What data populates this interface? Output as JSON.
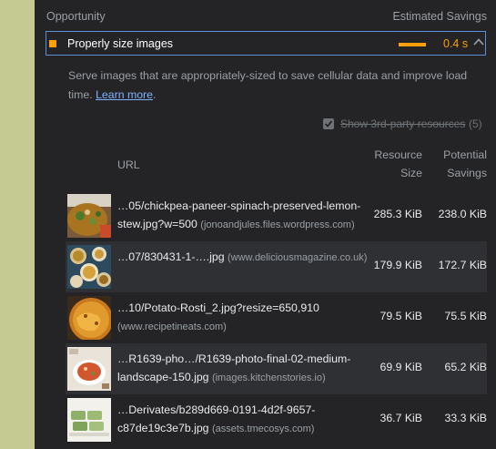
{
  "header": {
    "opportunity_label": "Opportunity",
    "estimated_savings_label": "Estimated Savings"
  },
  "audit": {
    "title": "Properly size images",
    "savings": "0.4 s",
    "status_color": "#ff9f0a"
  },
  "description": {
    "text": "Serve images that are appropriately-sized to save cellular data and improve load time.",
    "link_text": "Learn more",
    "trailing": "."
  },
  "third_party": {
    "label": "Show 3rd-party resources",
    "count": "(5)",
    "checked": true
  },
  "table": {
    "col_url": "URL",
    "col_resource_size": "Resource Size",
    "col_potential_savings": "Potential Savings",
    "rows": [
      {
        "url": "…05/chickpea-paneer-spinach-preserved-lemon-stew.jpg?w=500",
        "host": "(jonoandjules.files.wordpress.com)",
        "resource_size": "285.3 KiB",
        "potential_savings": "238.0 KiB",
        "thumb": "curry-dish-thumbnail"
      },
      {
        "url": "…07/830431-1-….jpg",
        "host": "(www.deliciousmagazine.co.uk)",
        "resource_size": "179.9 KiB",
        "potential_savings": "172.7 KiB",
        "thumb": "bowls-dish-thumbnail"
      },
      {
        "url": "…10/Potato-Rosti_2.jpg?resize=650,910",
        "host": "(www.recipetineats.com)",
        "resource_size": "79.5 KiB",
        "potential_savings": "75.5 KiB",
        "thumb": "rosti-dish-thumbnail"
      },
      {
        "url": "…R1639-pho…/R1639-photo-final-02-medium-landscape-150.jpg",
        "host": "(images.kitchenstories.io)",
        "resource_size": "69.9 KiB",
        "potential_savings": "65.2 KiB",
        "thumb": "soup-dish-thumbnail"
      },
      {
        "url": "…Derivates/b289d669-0191-4d2f-9657-c87de19c3e7b.jpg",
        "host": "(assets.tmecosys.com)",
        "resource_size": "36.7 KiB",
        "potential_savings": "33.3 KiB",
        "thumb": "green-cakes-thumbnail"
      }
    ]
  }
}
